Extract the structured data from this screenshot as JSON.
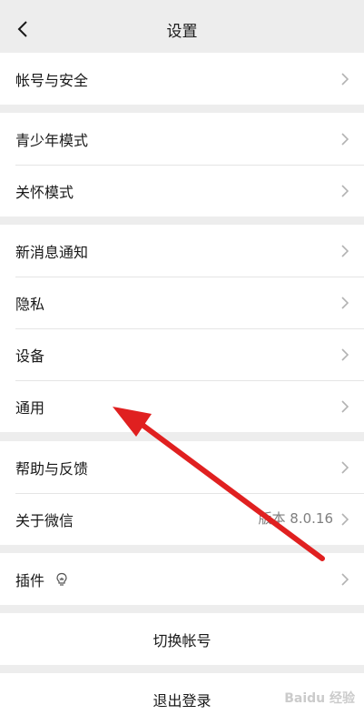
{
  "nav": {
    "title": "设置",
    "back_icon": "chevron-left-icon"
  },
  "groups": [
    {
      "items": [
        {
          "label": "帐号与安全"
        }
      ]
    },
    {
      "items": [
        {
          "label": "青少年模式"
        },
        {
          "label": "关怀模式"
        }
      ]
    },
    {
      "items": [
        {
          "label": "新消息通知"
        },
        {
          "label": "隐私"
        },
        {
          "label": "设备"
        },
        {
          "label": "通用"
        }
      ]
    },
    {
      "items": [
        {
          "label": "帮助与反馈"
        },
        {
          "label": "关于微信",
          "value": "版本 8.0.16"
        }
      ]
    },
    {
      "items": [
        {
          "label": "插件",
          "icon": "lightbulb-icon"
        }
      ]
    }
  ],
  "actions": {
    "switch_account": "切换帐号",
    "logout": "退出登录"
  },
  "annotation": {
    "arrow_color": "#e02020"
  },
  "watermark": "Baidu 经验"
}
